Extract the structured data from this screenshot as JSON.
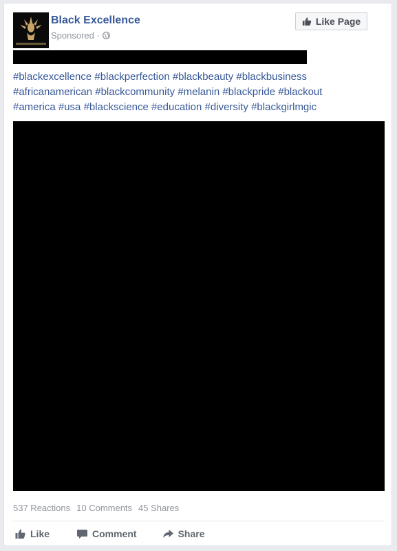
{
  "post": {
    "page_name": "Black Excellence",
    "sponsored_label": "Sponsored",
    "separator": "·",
    "like_page_label": "Like Page",
    "avatar_icon": "black-excellence-logo",
    "hashtags": [
      [
        "#blackexcellence",
        "#blackperfection",
        "#blackbeauty",
        "#blackbusiness"
      ],
      [
        "#africanamerican",
        "#blackcommunity",
        "#melanin",
        "#blackpride",
        "#blackout"
      ],
      [
        "#america",
        "#usa",
        "#blackscience",
        "#education",
        "#diversity",
        "#blackgirlmgic"
      ]
    ],
    "stats": {
      "reactions": "537 Reactions",
      "comments": "10 Comments",
      "shares": "45 Shares"
    },
    "actions": {
      "like": "Like",
      "comment": "Comment",
      "share": "Share"
    }
  },
  "colors": {
    "link": "#365899",
    "muted": "#90949c",
    "action_text": "#606770",
    "background": "#e9ebee"
  }
}
